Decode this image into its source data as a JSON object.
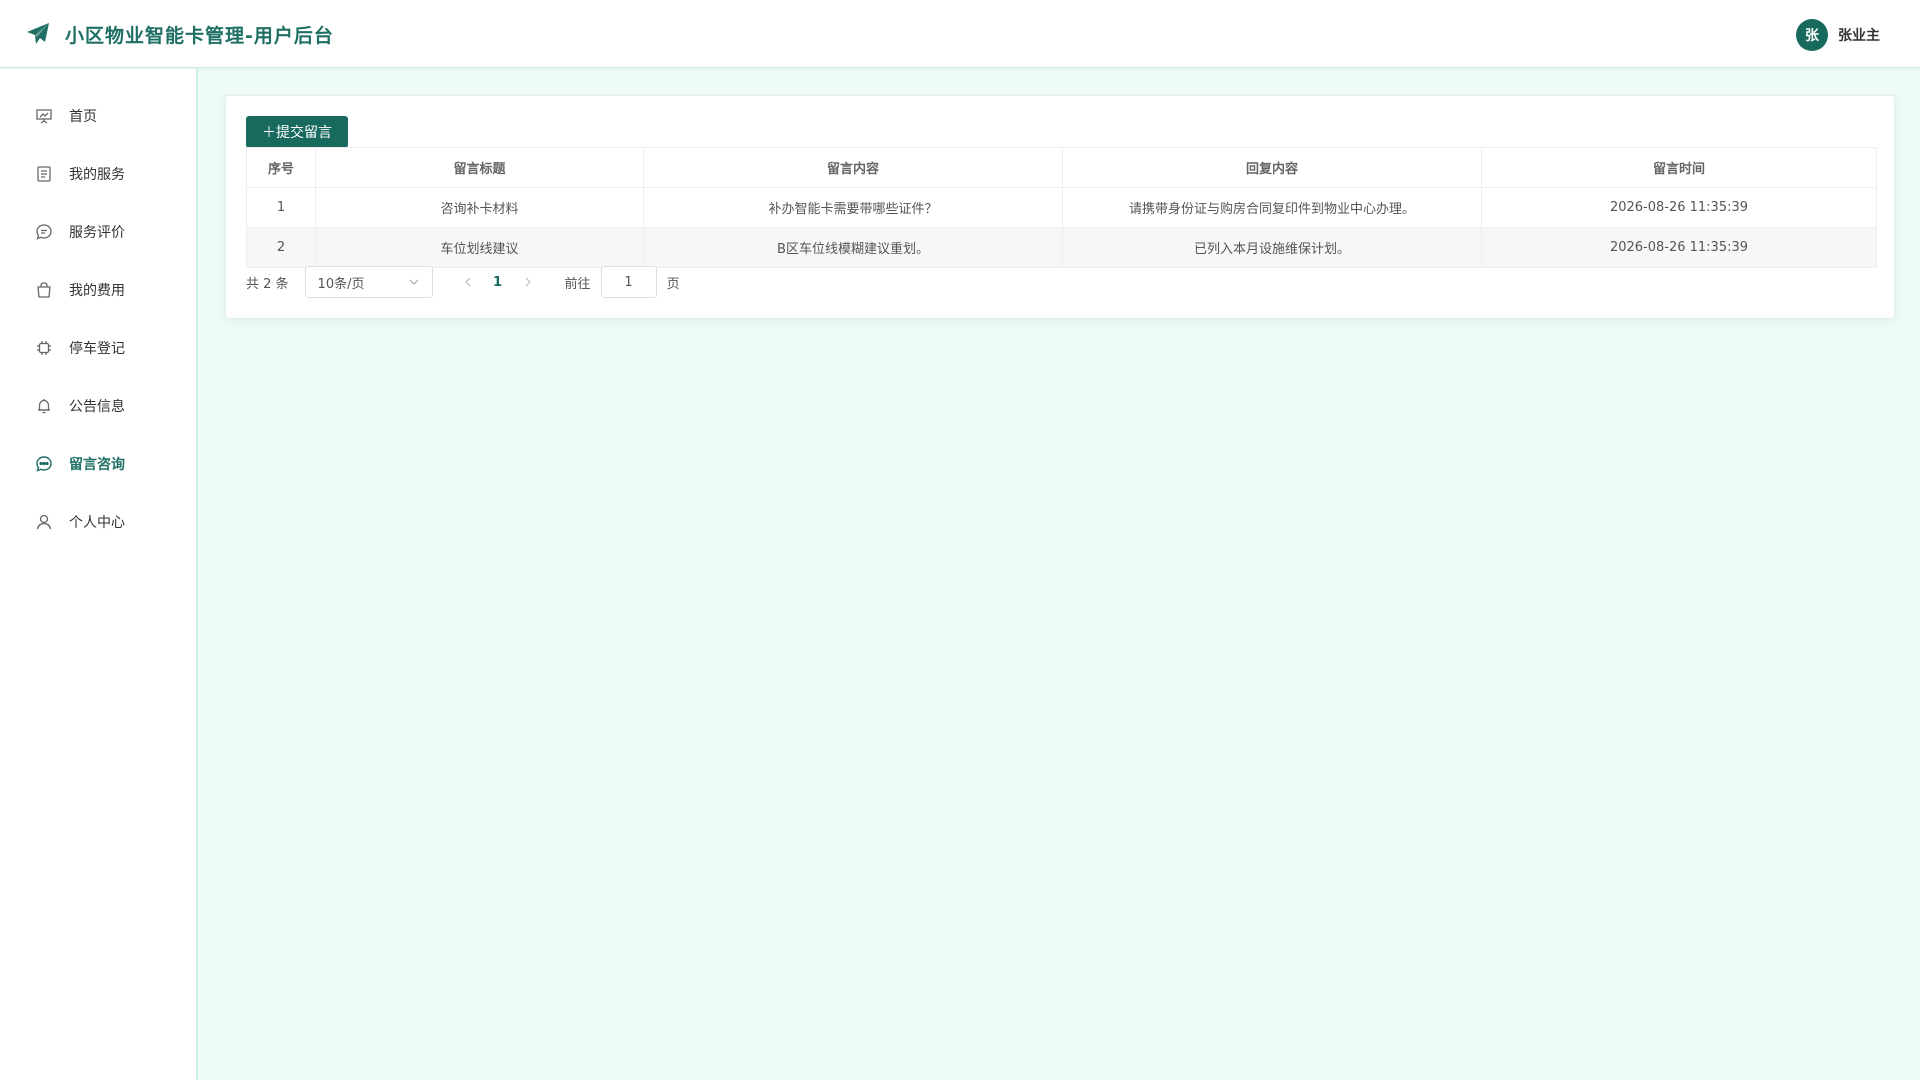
{
  "header": {
    "title": "小区物业智能卡管理-用户后台",
    "avatar_initial": "张",
    "username": "张业主"
  },
  "sidebar": {
    "items": [
      {
        "label": "首页",
        "icon": "presentation-board-icon",
        "active": false
      },
      {
        "label": "我的服务",
        "icon": "document-icon",
        "active": false
      },
      {
        "label": "服务评价",
        "icon": "chat-bubble-icon",
        "active": false
      },
      {
        "label": "我的费用",
        "icon": "shopping-bag-icon",
        "active": false
      },
      {
        "label": "停车登记",
        "icon": "cpu-chip-icon",
        "active": false
      },
      {
        "label": "公告信息",
        "icon": "bell-icon",
        "active": false
      },
      {
        "label": "留言咨询",
        "icon": "message-dots-icon",
        "active": true
      },
      {
        "label": "个人中心",
        "icon": "user-icon",
        "active": false
      }
    ]
  },
  "main": {
    "add_button_label": "＋提交留言",
    "table": {
      "columns": [
        "序号",
        "留言标题",
        "留言内容",
        "回复内容",
        "留言时间"
      ],
      "rows": [
        [
          "1",
          "咨询补卡材料",
          "补办智能卡需要带哪些证件？",
          "请携带身份证与购房合同复印件到物业中心办理。",
          "2026-08-26 11:35:39"
        ],
        [
          "2",
          "车位划线建议",
          "B区车位线模糊建议重划。",
          "已列入本月设施维保计划。",
          "2026-08-26 11:35:39"
        ]
      ]
    },
    "pagination": {
      "total_text": "共 2 条",
      "page_size": "10条/页",
      "current_page": "1",
      "goto_label": "前往",
      "goto_value": "1",
      "page_suffix": "页"
    }
  },
  "colors": {
    "primary": "#186a5e",
    "title": "#1f6f64",
    "background": "#eefbf7"
  }
}
